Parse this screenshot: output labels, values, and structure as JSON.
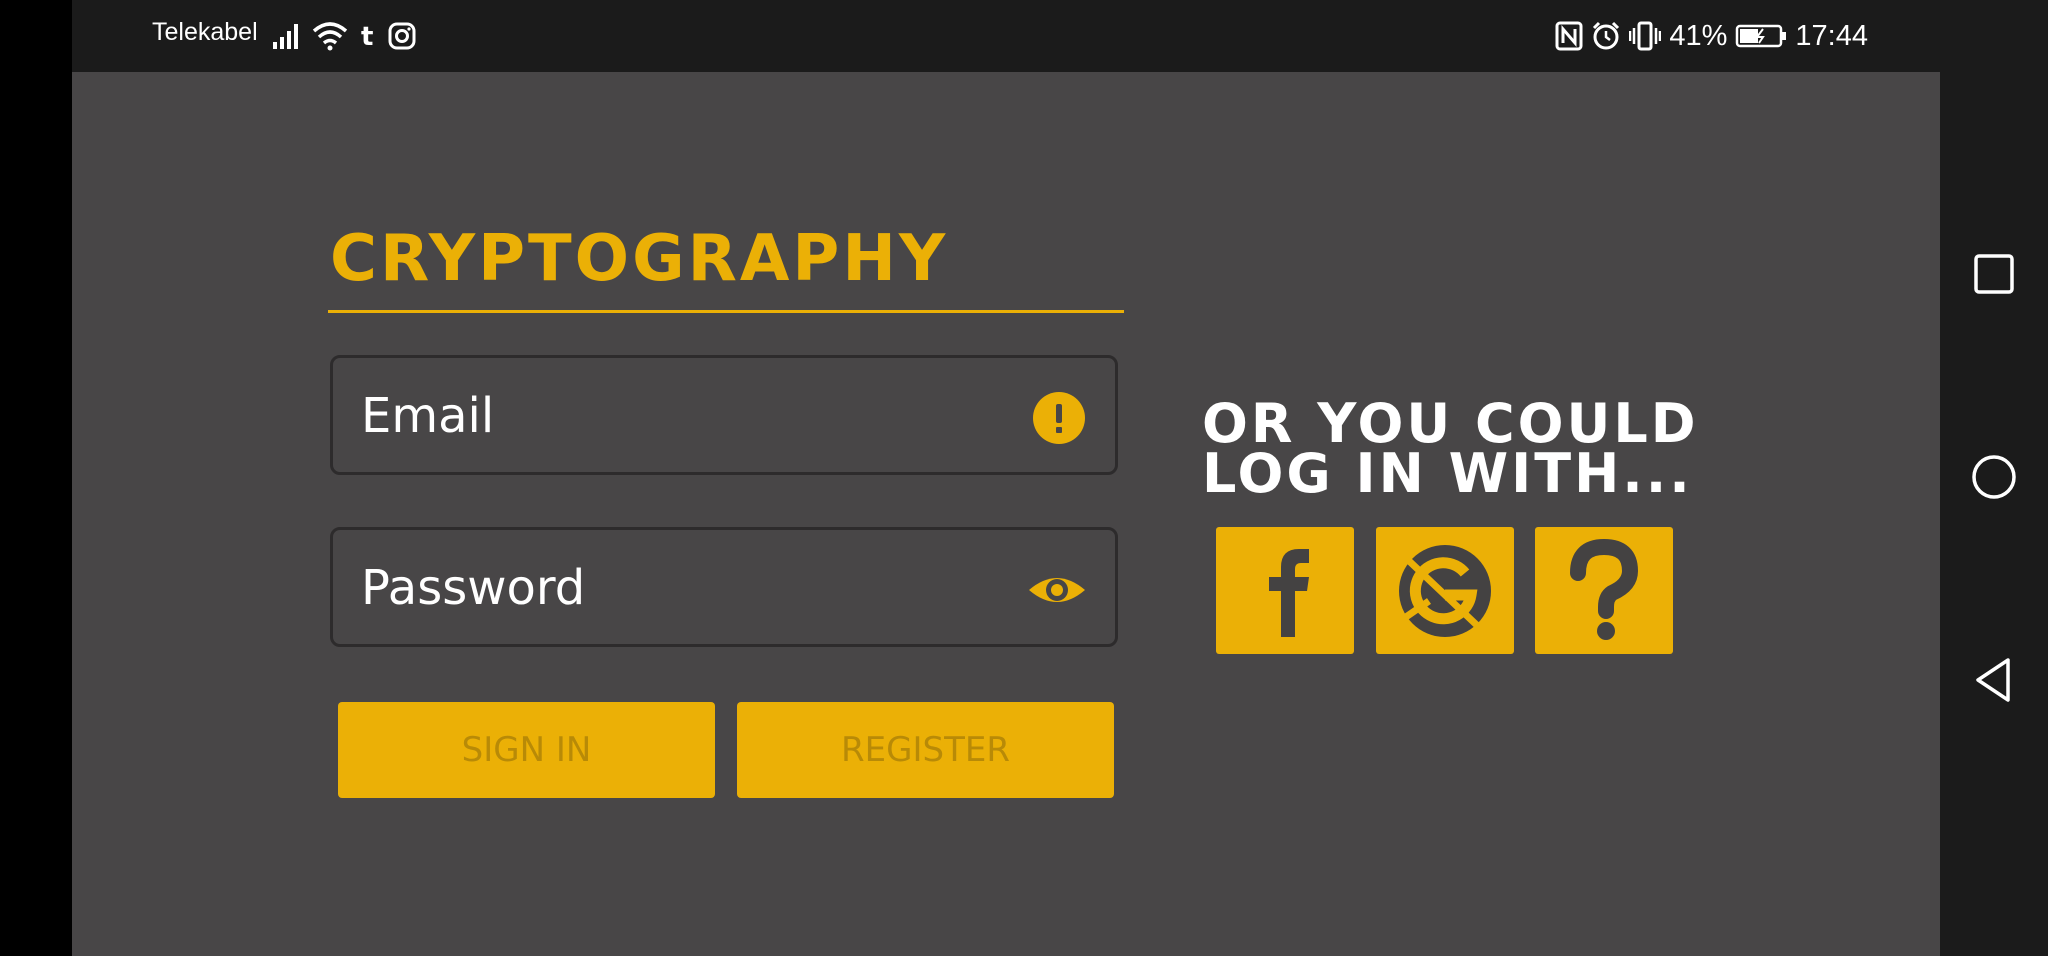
{
  "status_bar": {
    "carrier": "Telekabel",
    "battery": "41%",
    "time": "17:44",
    "icons_left": [
      "signal-icon",
      "wifi-icon",
      "tumblr-icon",
      "instagram-icon"
    ],
    "icons_right": [
      "nfc-icon",
      "alarm-icon",
      "vibrate-icon",
      "battery-icon"
    ]
  },
  "login": {
    "title": "CRYPTOGRAPHY",
    "email_placeholder": "Email",
    "password_placeholder": "Password",
    "sign_in_label": "SIGN IN",
    "register_label": "REGISTER"
  },
  "social_login": {
    "prompt_line1": "OR YOU COULD",
    "prompt_line2": "LOG IN WITH...",
    "providers": [
      "facebook-icon",
      "google-icon",
      "unknown-provider-icon"
    ]
  },
  "nav_bar": {
    "buttons": [
      "recents-icon",
      "home-icon",
      "back-icon"
    ]
  },
  "colors": {
    "accent": "#ebb006",
    "background": "#484647",
    "bar": "#1b1b1b",
    "button_text": "#b88a07"
  }
}
